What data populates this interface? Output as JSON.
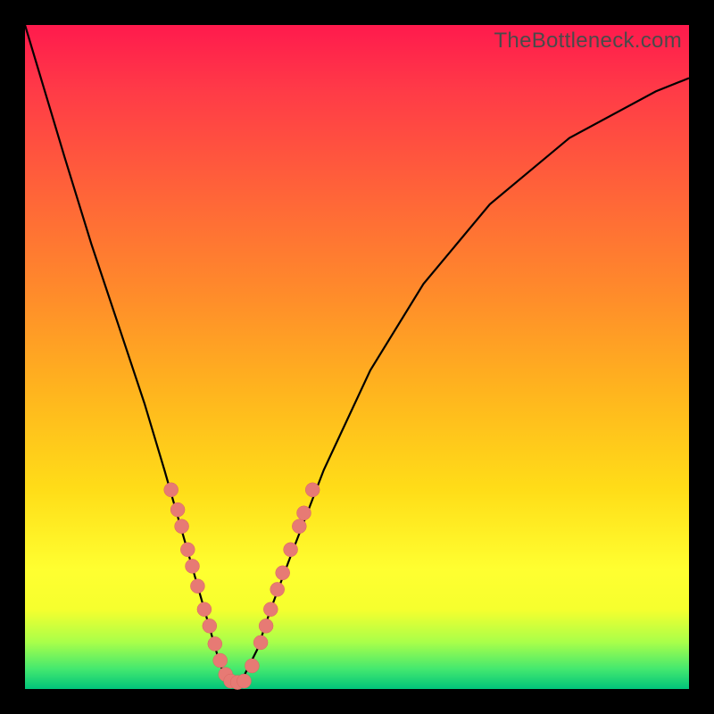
{
  "watermark": "TheBottleneck.com",
  "chart_data": {
    "type": "line",
    "title": "",
    "xlabel": "",
    "ylabel": "",
    "xlim": [
      0,
      100
    ],
    "ylim": [
      0,
      100
    ],
    "series": [
      {
        "name": "bottleneck-curve",
        "x": [
          0,
          3,
          6,
          10,
          14,
          18,
          21,
          25,
          27,
          29,
          30,
          31,
          33,
          35,
          37,
          40,
          45,
          52,
          60,
          70,
          82,
          95,
          100
        ],
        "y": [
          100,
          90,
          80,
          67,
          55,
          43,
          33,
          19,
          12,
          5,
          2,
          1,
          2,
          6,
          12,
          20,
          33,
          48,
          61,
          73,
          83,
          90,
          92
        ]
      }
    ],
    "markers": [
      {
        "x": 22,
        "y": 30
      },
      {
        "x": 23,
        "y": 27
      },
      {
        "x": 23.6,
        "y": 24.5
      },
      {
        "x": 24.5,
        "y": 21
      },
      {
        "x": 25.2,
        "y": 18.5
      },
      {
        "x": 26,
        "y": 15.5
      },
      {
        "x": 27,
        "y": 12
      },
      {
        "x": 27.8,
        "y": 9.5
      },
      {
        "x": 28.6,
        "y": 6.8
      },
      {
        "x": 29.4,
        "y": 4.3
      },
      {
        "x": 30.2,
        "y": 2.2
      },
      {
        "x": 31,
        "y": 1.2
      },
      {
        "x": 32,
        "y": 1
      },
      {
        "x": 33,
        "y": 1.2
      },
      {
        "x": 34.2,
        "y": 3.5
      },
      {
        "x": 35.5,
        "y": 7
      },
      {
        "x": 36.3,
        "y": 9.5
      },
      {
        "x": 37,
        "y": 12
      },
      {
        "x": 38,
        "y": 15
      },
      {
        "x": 38.8,
        "y": 17.5
      },
      {
        "x": 40,
        "y": 21
      },
      {
        "x": 41.3,
        "y": 24.5
      },
      {
        "x": 42,
        "y": 26.5
      },
      {
        "x": 43.3,
        "y": 30
      }
    ],
    "marker_color": "#e77a74"
  }
}
